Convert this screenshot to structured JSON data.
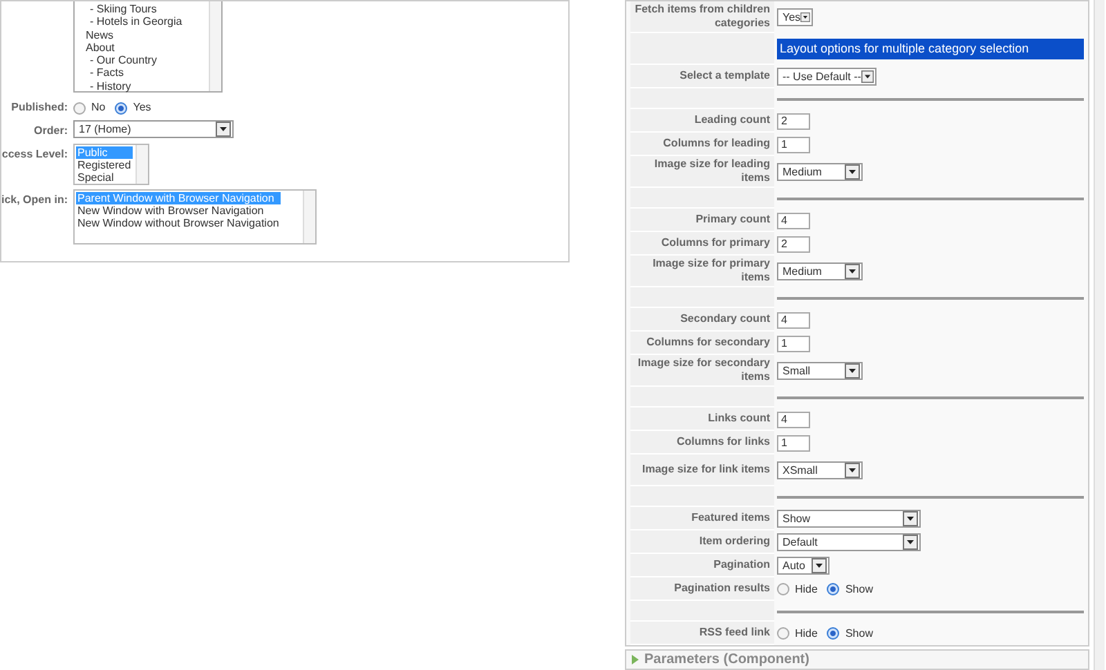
{
  "left": {
    "menu_list": [
      "- Skiing Tours",
      "- Hotels in Georgia",
      "News",
      "About",
      "- Our Country",
      "- Facts",
      "- History"
    ],
    "fields": [
      {
        "kind": "radio",
        "label": "Published:",
        "options": [
          {
            "label": "No",
            "selected": false
          },
          {
            "label": "Yes",
            "selected": true
          }
        ]
      },
      {
        "kind": "select",
        "label": "Order:",
        "value": "17 (Home)"
      },
      {
        "kind": "list",
        "label": "ccess Level:",
        "items": [
          {
            "label": "Public",
            "selected": true
          },
          {
            "label": "Registered",
            "selected": false
          },
          {
            "label": "Special",
            "selected": false
          }
        ]
      },
      {
        "kind": "list",
        "label": "ick, Open in:",
        "items": [
          {
            "label": "Parent Window with Browser Navigation",
            "selected": true
          },
          {
            "label": "New Window with Browser Navigation",
            "selected": false
          },
          {
            "label": "New Window without Browser Navigation",
            "selected": false
          }
        ]
      }
    ]
  },
  "right": {
    "rows": [
      {
        "kind": "select",
        "label": "Fetch items from children categories",
        "value": "Yes"
      },
      {
        "kind": "header",
        "label": "Layout options for multiple category selection"
      },
      {
        "kind": "select",
        "label": "Select a template",
        "value": "-- Use Default --"
      },
      {
        "kind": "separator"
      },
      {
        "kind": "text",
        "label": "Leading count",
        "value": "2"
      },
      {
        "kind": "text",
        "label": "Columns for leading",
        "value": "1"
      },
      {
        "kind": "select",
        "label": "Image size for leading items",
        "value": "Medium"
      },
      {
        "kind": "separator"
      },
      {
        "kind": "text",
        "label": "Primary count",
        "value": "4"
      },
      {
        "kind": "text",
        "label": "Columns for primary",
        "value": "2"
      },
      {
        "kind": "select",
        "label": "Image size for primary items",
        "value": "Medium"
      },
      {
        "kind": "separator"
      },
      {
        "kind": "text",
        "label": "Secondary count",
        "value": "4"
      },
      {
        "kind": "text",
        "label": "Columns for secondary",
        "value": "1"
      },
      {
        "kind": "select",
        "label": "Image size for secondary items",
        "value": "Small"
      },
      {
        "kind": "separator"
      },
      {
        "kind": "text",
        "label": "Links count",
        "value": "4"
      },
      {
        "kind": "text",
        "label": "Columns for links",
        "value": "1"
      },
      {
        "kind": "select",
        "label": "Image size for link items",
        "value": "XSmall"
      },
      {
        "kind": "separator"
      },
      {
        "kind": "select",
        "label": "Featured items",
        "value": "Show"
      },
      {
        "kind": "select",
        "label": "Item ordering",
        "value": "Default"
      },
      {
        "kind": "select",
        "label": "Pagination",
        "value": "Auto"
      },
      {
        "kind": "radio",
        "label": "Pagination results",
        "options": [
          {
            "label": "Hide",
            "selected": false
          },
          {
            "label": "Show",
            "selected": true
          }
        ]
      },
      {
        "kind": "separator"
      },
      {
        "kind": "radio",
        "label": "RSS feed link",
        "options": [
          {
            "label": "Hide",
            "selected": false
          },
          {
            "label": "Show",
            "selected": true
          }
        ]
      }
    ],
    "collapsed_panel": {
      "title": "Parameters (Component)",
      "expanded": false
    }
  }
}
